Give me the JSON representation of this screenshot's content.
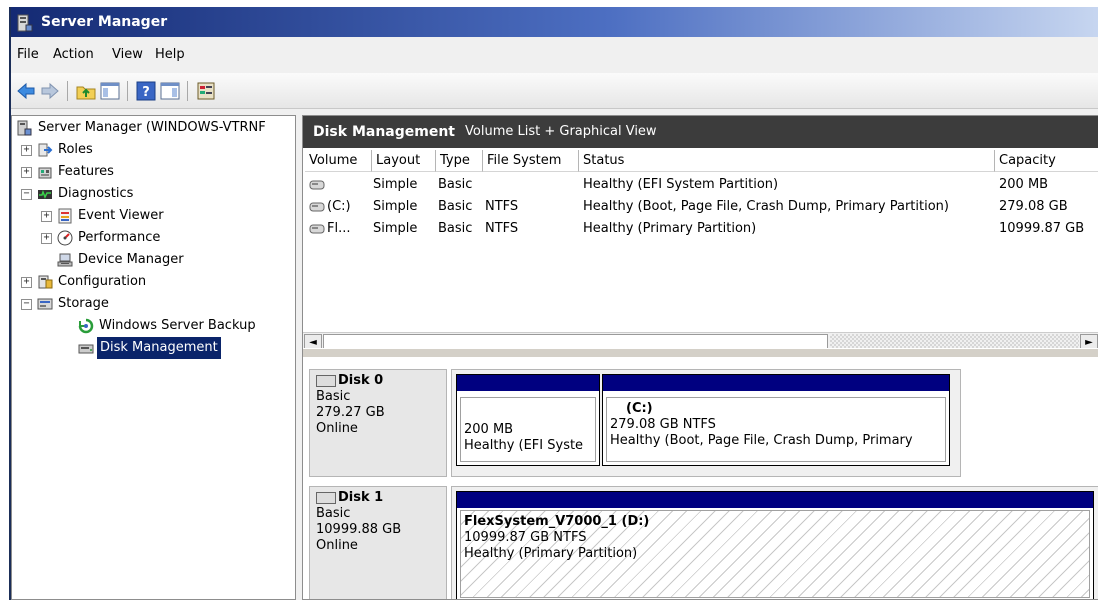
{
  "window": {
    "title": "Server Manager"
  },
  "menu": [
    "File",
    "Action",
    "View",
    "Help"
  ],
  "toolbar": {
    "icons": [
      "back-arrow-icon",
      "forward-arrow-icon",
      "up-folder-icon",
      "show-hide-tree-icon",
      "help-icon",
      "show-hide-action-pane-icon",
      "properties-icon"
    ]
  },
  "tree": {
    "root": "Server Manager (WINDOWS-VTRNF",
    "roles": "Roles",
    "features": "Features",
    "diagnostics": "Diagnostics",
    "event_viewer": "Event Viewer",
    "performance": "Performance",
    "device_manager": "Device Manager",
    "configuration": "Configuration",
    "storage": "Storage",
    "backup": "Windows Server Backup",
    "disk_management": "Disk Management",
    "expanders": {
      "collapsed": "+",
      "expanded": "−"
    }
  },
  "content": {
    "title": "Disk Management",
    "subtitle": "Volume List + Graphical View",
    "columns": [
      "Volume",
      "Layout",
      "Type",
      "File System",
      "Status",
      "Capacity"
    ],
    "volumes": [
      {
        "volume": "",
        "layout": "Simple",
        "type": "Basic",
        "fs": "",
        "status": "Healthy (EFI System Partition)",
        "capacity": "200 MB"
      },
      {
        "volume": "(C:)",
        "layout": "Simple",
        "type": "Basic",
        "fs": "NTFS",
        "status": "Healthy (Boot, Page File, Crash Dump, Primary Partition)",
        "capacity": "279.08 GB"
      },
      {
        "volume": "Fl...",
        "layout": "Simple",
        "type": "Basic",
        "fs": "NTFS",
        "status": "Healthy (Primary Partition)",
        "capacity": "10999.87 GB"
      }
    ],
    "scroll": {
      "left": "◄",
      "right": "►"
    }
  },
  "disks": [
    {
      "name": "Disk 0",
      "type": "Basic",
      "size": "279.27 GB",
      "status": "Online",
      "partitions": [
        {
          "label": "",
          "size": "200 MB",
          "status": "Healthy (EFI Syste"
        },
        {
          "label": "(C:)",
          "size": "279.08 GB NTFS",
          "status": "Healthy (Boot, Page File, Crash Dump, Primary"
        }
      ]
    },
    {
      "name": "Disk 1",
      "type": "Basic",
      "size": "10999.88 GB",
      "status": "Online",
      "partitions": [
        {
          "label": "FlexSystem_V7000_1  (D:)",
          "size": "10999.87 GB NTFS",
          "status": "Healthy (Primary Partition)"
        }
      ]
    }
  ],
  "colors": {
    "partition_bar": "#000080",
    "header_bg": "#3c3c3c",
    "selection": "#0a246a"
  }
}
